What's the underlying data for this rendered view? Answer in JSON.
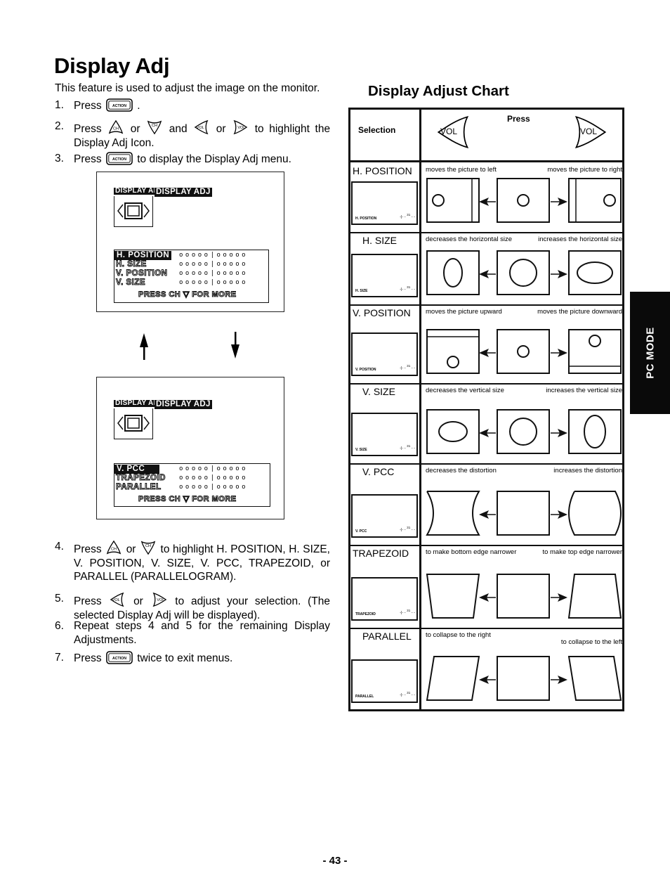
{
  "page": {
    "title": "Display Adj",
    "intro": "This feature is used to adjust the image on the monitor.",
    "page_number": "- 43 -",
    "side_tab": "PC MODE"
  },
  "steps_top": [
    {
      "num": "1.",
      "parts": [
        "Press",
        "{action}",
        "."
      ]
    },
    {
      "num": "2.",
      "parts": [
        "Press",
        "{ch-up}",
        "or",
        "{ch-down}",
        "and",
        "{vol-left}",
        "or",
        "{vol-right}",
        "to highlight the Display Adj Icon."
      ]
    },
    {
      "num": "3.",
      "parts": [
        "Press",
        "{action}",
        "to display the Display Adj menu."
      ]
    }
  ],
  "step_texts": {
    "s1_a": "Press",
    "s1_b": ".",
    "s2_a": "Press",
    "s2_or1": "or",
    "s2_and": "and",
    "s2_or2": "or",
    "s2_b": "to highlight the Display Adj Icon.",
    "s3_a": "Press",
    "s3_b": "to display the Display Adj menu.",
    "s4_a": "Press",
    "s4_or": "or",
    "s4_b": "to highlight H. POSITION, H. SIZE, V. POSITION, V. SIZE, V. PCC, TRAPEZOID, or PARALLEL (PARALLELOGRAM).",
    "s5_a": "Press",
    "s5_or": "or",
    "s5_b": "to adjust your selection. (The selected Display Adj will be displayed).",
    "s6": "Repeat steps 4 and 5 for the remaining Display Adjustments.",
    "s7_a": "Press",
    "s7_b": "twice to exit menus."
  },
  "step_numbers": [
    "1.",
    "2.",
    "3.",
    "4.",
    "5.",
    "6.",
    "7."
  ],
  "buttons": {
    "action_label": "ACTION",
    "ch_label": "CH",
    "vol_label": "VOL"
  },
  "osd_screen_1": {
    "icon_tag": "DISPLAY ADJ",
    "header": "DISPLAY ADJ",
    "items": [
      {
        "label": "H. POSITION",
        "selected": true,
        "level": 0.5
      },
      {
        "label": "H. SIZE",
        "selected": false,
        "level": 0.5
      },
      {
        "label": "V. POSITION",
        "selected": false,
        "level": 0.5
      },
      {
        "label": "V. SIZE",
        "selected": false,
        "level": 0.5
      }
    ],
    "footer": "PRESS CH ▽ FOR MORE"
  },
  "osd_screen_2": {
    "icon_tag": "DISPLAY ADJ",
    "header": "DISPLAY ADJ",
    "items": [
      {
        "label": "V. PCC",
        "selected": true,
        "level": 0.5
      },
      {
        "label": "TRAPEZOID",
        "selected": false,
        "level": 0.5
      },
      {
        "label": "PARALLEL",
        "selected": false,
        "level": 0.5
      }
    ],
    "footer": "PRESS CH ▽ FOR MORE"
  },
  "chart": {
    "title": "Display Adjust Chart",
    "header_selection": "Selection",
    "header_press": "Press",
    "left_button": "VOL",
    "right_button": "VOL",
    "mini_value": "31",
    "rows": [
      {
        "label": "H. POSITION",
        "mini_label": "H. POSITION",
        "left": "moves the picture to left",
        "right": "moves the picture to right"
      },
      {
        "label": "H. SIZE",
        "mini_label": "H. SIZE",
        "left": "decreases the horizontal size",
        "right": "increases the horizontal size"
      },
      {
        "label": "V. POSITION",
        "mini_label": "V. POSITION",
        "left": "moves the picture upward",
        "right": "moves the picture downward"
      },
      {
        "label": "V. SIZE",
        "mini_label": "V. SIZE",
        "left": "decreases the vertical size",
        "right": "increases the vertical size"
      },
      {
        "label": "V. PCC",
        "mini_label": "V. PCC",
        "left": "decreases the distortion",
        "right": "increases the distortion"
      },
      {
        "label": "TRAPEZOID",
        "mini_label": "TRAPEZOID",
        "left": "to make bottom edge narrower",
        "right": "to make top edge narrower"
      },
      {
        "label": "PARALLEL",
        "mini_label": "PARALLEL",
        "left": "to collapse to the right",
        "right": "to collapse to the left"
      }
    ]
  }
}
